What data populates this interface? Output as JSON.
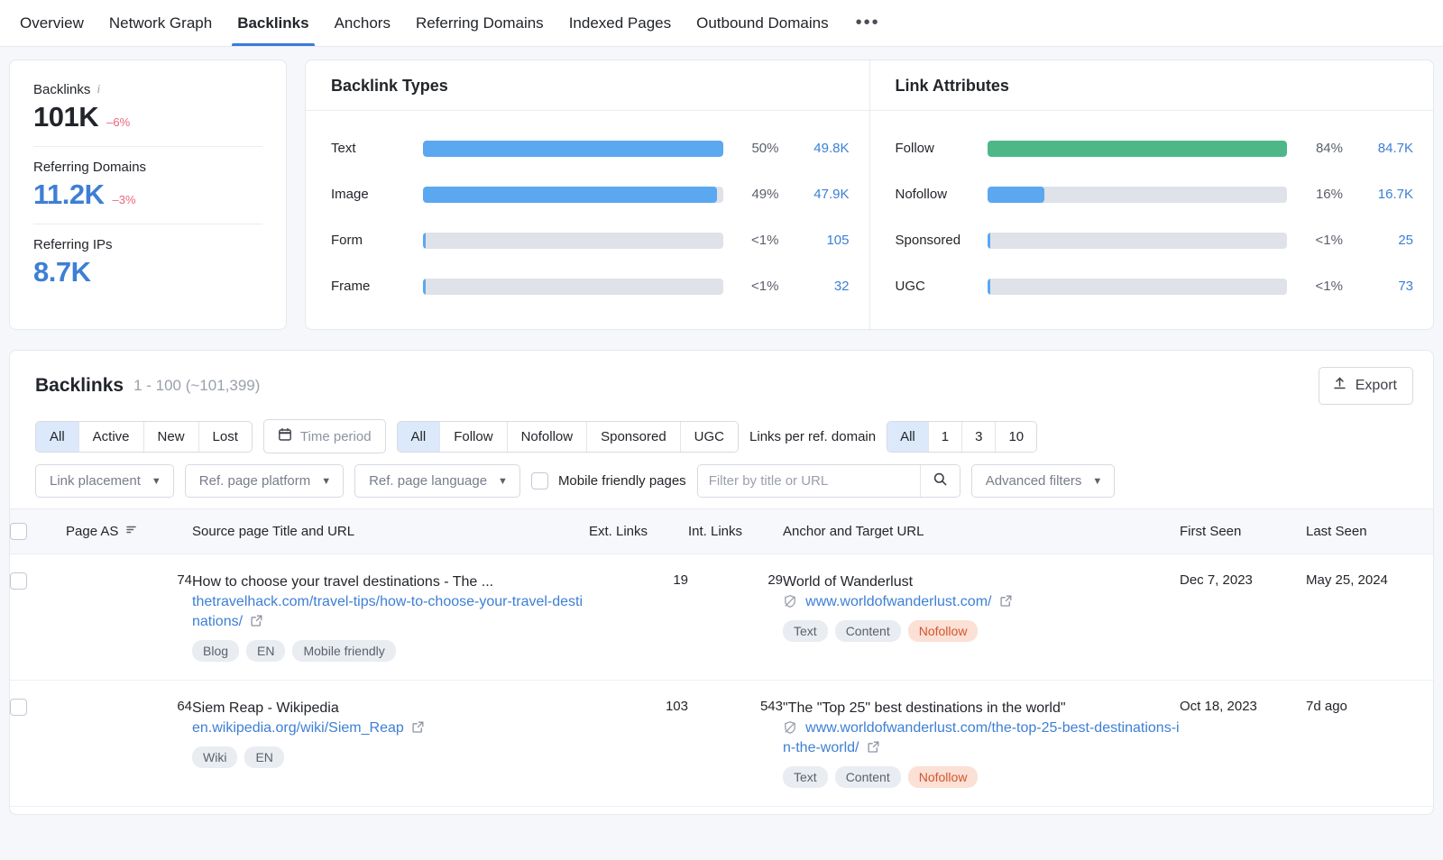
{
  "tabs": [
    {
      "label": "Overview",
      "active": false
    },
    {
      "label": "Network Graph",
      "active": false
    },
    {
      "label": "Backlinks",
      "active": true
    },
    {
      "label": "Anchors",
      "active": false
    },
    {
      "label": "Referring Domains",
      "active": false
    },
    {
      "label": "Indexed Pages",
      "active": false
    },
    {
      "label": "Outbound Domains",
      "active": false
    }
  ],
  "tab_more": "•••",
  "stats": [
    {
      "label": "Backlinks",
      "value": "101K",
      "delta": "–6%",
      "has_info": true,
      "blue": false
    },
    {
      "label": "Referring Domains",
      "value": "11.2K",
      "delta": "–3%",
      "has_info": false,
      "blue": true
    },
    {
      "label": "Referring IPs",
      "value": "8.7K",
      "delta": "",
      "has_info": false,
      "blue": true
    }
  ],
  "backlink_types": {
    "title": "Backlink Types",
    "rows": [
      {
        "name": "Text",
        "pct": "50%",
        "fill": 100,
        "count": "49.8K",
        "color": "#5ba7f0"
      },
      {
        "name": "Image",
        "pct": "49%",
        "fill": 98,
        "count": "47.9K",
        "color": "#5ba7f0"
      },
      {
        "name": "Form",
        "pct": "<1%",
        "fill": 1,
        "count": "105",
        "color": "#5ba7f0"
      },
      {
        "name": "Frame",
        "pct": "<1%",
        "fill": 1,
        "count": "32",
        "color": "#5ba7f0"
      }
    ]
  },
  "link_attributes": {
    "title": "Link Attributes",
    "rows": [
      {
        "name": "Follow",
        "pct": "84%",
        "fill": 100,
        "count": "84.7K",
        "color": "#4db788"
      },
      {
        "name": "Nofollow",
        "pct": "16%",
        "fill": 19,
        "count": "16.7K",
        "color": "#5ba7f0"
      },
      {
        "name": "Sponsored",
        "pct": "<1%",
        "fill": 1,
        "count": "25",
        "color": "#5ba7f0"
      },
      {
        "name": "UGC",
        "pct": "<1%",
        "fill": 1,
        "count": "73",
        "color": "#5ba7f0"
      }
    ]
  },
  "chart_data": {
    "type": "bar",
    "title": "Backlink Types / Link Attributes",
    "charts": [
      {
        "title": "Backlink Types",
        "categories": [
          "Text",
          "Image",
          "Form",
          "Frame"
        ],
        "values": [
          49800,
          47900,
          105,
          32
        ],
        "percent_labels": [
          "50%",
          "49%",
          "<1%",
          "<1%"
        ],
        "value_labels": [
          "49.8K",
          "47.9K",
          "105",
          "32"
        ],
        "orientation": "horizontal"
      },
      {
        "title": "Link Attributes",
        "categories": [
          "Follow",
          "Nofollow",
          "Sponsored",
          "UGC"
        ],
        "values": [
          84700,
          16700,
          25,
          73
        ],
        "percent_labels": [
          "84%",
          "16%",
          "<1%",
          "<1%"
        ],
        "value_labels": [
          "84.7K",
          "16.7K",
          "25",
          "73"
        ],
        "orientation": "horizontal"
      }
    ]
  },
  "backlinks_panel": {
    "title": "Backlinks",
    "count": "1 - 100 (~101,399)",
    "export_label": "Export"
  },
  "filters": {
    "status": {
      "options": [
        "All",
        "Active",
        "New",
        "Lost"
      ],
      "selected": "All"
    },
    "time_period": "Time period",
    "attribute": {
      "options": [
        "All",
        "Follow",
        "Nofollow",
        "Sponsored",
        "UGC"
      ],
      "selected": "All"
    },
    "links_per_domain_label": "Links per ref. domain",
    "links_per_domain": {
      "options": [
        "All",
        "1",
        "3",
        "10"
      ],
      "selected": "All"
    },
    "dropdowns": [
      "Link placement",
      "Ref. page platform",
      "Ref. page language"
    ],
    "mobile_friendly_label": "Mobile friendly pages",
    "search_placeholder": "Filter by title or URL",
    "search_value": "",
    "advanced_filters": "Advanced filters"
  },
  "table": {
    "columns": [
      "Page AS",
      "Source page Title and URL",
      "Ext. Links",
      "Int. Links",
      "Anchor and Target URL",
      "First Seen",
      "Last Seen"
    ],
    "rows": [
      {
        "page_as": "74",
        "source_title": "How to choose your travel destinations - The ...",
        "source_url": "thetravelhack.com/travel-tips/how-to-choose-your-travel-destinations/",
        "source_tags": [
          "Blog",
          "EN",
          "Mobile friendly"
        ],
        "ext_links": "19",
        "int_links": "29",
        "anchor_title": "World of Wanderlust",
        "target_url": "www.worldofwanderlust.com/",
        "anchor_tags": [
          "Text",
          "Content"
        ],
        "anchor_tag_warn": "Nofollow",
        "first_seen": "Dec 7, 2023",
        "last_seen": "May 25, 2024"
      },
      {
        "page_as": "64",
        "source_title": "Siem Reap - Wikipedia",
        "source_url": "en.wikipedia.org/wiki/Siem_Reap",
        "source_tags": [
          "Wiki",
          "EN"
        ],
        "ext_links": "103",
        "int_links": "543",
        "anchor_title": "\"The \"Top 25\" best destinations in the world\"",
        "target_url": "www.worldofwanderlust.com/the-top-25-best-destinations-in-the-world/",
        "anchor_tags": [
          "Text",
          "Content"
        ],
        "anchor_tag_warn": "Nofollow",
        "first_seen": "Oct 18, 2023",
        "last_seen": "7d ago"
      }
    ]
  }
}
